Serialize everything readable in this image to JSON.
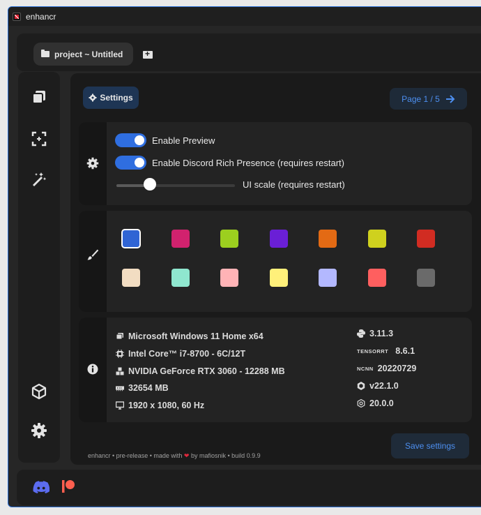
{
  "window": {
    "title": "enhancr"
  },
  "topbar": {
    "project_label": "project ~ Untitled",
    "new_project_icon": "folder-plus-icon"
  },
  "sidebar": {
    "items": [
      {
        "name": "media-icon"
      },
      {
        "name": "upscale-icon"
      },
      {
        "name": "magic-wand-icon"
      },
      {
        "name": "cube-icon"
      },
      {
        "name": "settings-gear-icon",
        "active": true
      }
    ]
  },
  "settings": {
    "tab_label": "Settings",
    "page_label": "Page 1 / 5",
    "options": [
      {
        "label": "Enable Preview",
        "enabled": true
      },
      {
        "label": "Enable Discord Rich Presence (requires restart)",
        "enabled": true
      }
    ],
    "slider": {
      "label": "UI scale (requires restart)",
      "value_fraction": 0.28
    },
    "theme_colors": [
      "#2f64d4",
      "#d1226e",
      "#9ccf1f",
      "#6a1fd6",
      "#e36a14",
      "#cfd11e",
      "#d12c22",
      "#f2ddc2",
      "#8fe7cf",
      "#ffb3b6",
      "#fff07a",
      "#b3b8ff",
      "#ff5f5f",
      "#6a6a6a"
    ],
    "selected_color": "#2f64d4"
  },
  "system": {
    "os": "Microsoft Windows 11 Home x64",
    "cpu": "Intel Core™ i7-8700 - 6C/12T",
    "gpu": "NVIDIA GeForce RTX 3060 - 12288 MB",
    "ram": "32654 MB",
    "display": "1920 x 1080, 60 Hz"
  },
  "versions": {
    "python": "3.11.3",
    "tensorrt_label": "TENSORRT",
    "tensorrt": "8.6.1",
    "ncnn_label": "NCNN",
    "ncnn": "20220729",
    "node": "v22.1.0",
    "electron": "20.0.0"
  },
  "footer": {
    "text_a": "enhancr • pre-release • made with",
    "text_b": "by mafiosnik • build 0.9.9",
    "save_label": "Save settings"
  }
}
